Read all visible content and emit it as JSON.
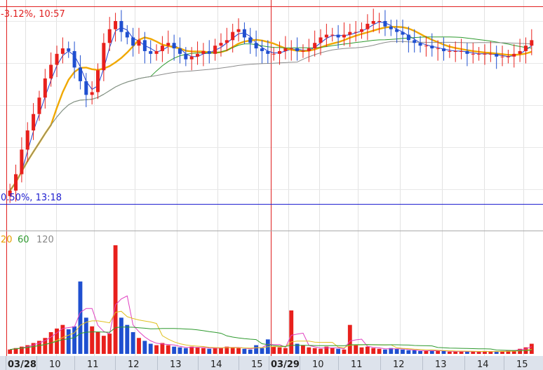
{
  "chart_data": {
    "type": "candlestick",
    "annotations": {
      "high_label": "-3.12%, 10:57",
      "low_label": "0.50%, 13:18"
    },
    "volume_legend": [
      {
        "label": "20",
        "color": "#e8a000"
      },
      {
        "label": "60",
        "color": "#2e9a2e"
      },
      {
        "label": "120",
        "color": "#888888"
      }
    ],
    "x_ticks": [
      "03/28",
      "10",
      "11",
      "12",
      "13",
      "14",
      "15",
      "03/29",
      "10",
      "11",
      "12",
      "13",
      "14",
      "15"
    ],
    "x_tick_bold": [
      true,
      false,
      false,
      false,
      false,
      false,
      false,
      true,
      false,
      false,
      false,
      false,
      false,
      false
    ],
    "colors": {
      "up": "#e8201c",
      "down": "#1f4fd0",
      "ma_short": "#1f3fd0",
      "ma20": "#f0a800",
      "ma60": "#2e9a2e",
      "ma120": "#8c8c8c",
      "high_line": "#e02020",
      "low_line": "#2020d0",
      "vol_ma_pink": "#e040c0",
      "vol_ma_yellow": "#e0c020",
      "vol_ma_green": "#2e9a2e",
      "axis_bg": "#dde3ec"
    },
    "price_close": [
      0.0,
      0.6,
      1.5,
      2.2,
      2.8,
      3.4,
      4.1,
      4.6,
      5.0,
      5.2,
      5.1,
      4.5,
      4.0,
      3.5,
      3.6,
      4.4,
      5.4,
      5.9,
      6.2,
      5.8,
      5.6,
      5.3,
      5.5,
      5.1,
      5.0,
      5.1,
      5.3,
      5.4,
      5.2,
      5.0,
      4.8,
      4.9,
      5.0,
      5.1,
      5.0,
      5.3,
      5.4,
      5.5,
      5.8,
      5.9,
      5.6,
      5.4,
      5.2,
      5.1,
      5.0,
      5.0,
      5.1,
      5.2,
      5.2,
      5.1,
      5.1,
      5.2,
      5.4,
      5.6,
      5.7,
      5.7,
      5.6,
      5.7,
      5.8,
      5.8,
      5.9,
      6.1,
      6.2,
      6.2,
      6.0,
      5.9,
      5.8,
      5.7,
      5.5,
      5.4,
      5.3,
      5.3,
      5.2,
      5.2,
      5.1,
      5.1,
      5.1,
      5.1,
      5.0,
      5.0,
      5.0,
      5.0,
      5.0,
      4.9,
      4.9,
      4.9,
      5.0,
      5.1,
      5.3,
      5.5
    ],
    "volume": [
      6,
      8,
      10,
      12,
      15,
      18,
      22,
      30,
      35,
      40,
      34,
      38,
      100,
      50,
      38,
      30,
      25,
      28,
      150,
      50,
      40,
      30,
      22,
      18,
      14,
      12,
      15,
      12,
      10,
      9,
      8,
      10,
      9,
      8,
      7,
      9,
      8,
      10,
      9,
      8,
      7,
      6,
      12,
      8,
      20,
      10,
      9,
      8,
      60,
      14,
      12,
      9,
      8,
      7,
      10,
      8,
      7,
      6,
      40,
      12,
      9,
      10,
      8,
      7,
      6,
      8,
      7,
      6,
      5,
      5,
      4,
      4,
      5,
      4,
      4,
      3,
      3,
      4,
      3,
      3,
      3,
      4,
      3,
      3,
      4,
      5,
      5,
      7,
      9,
      14
    ]
  }
}
